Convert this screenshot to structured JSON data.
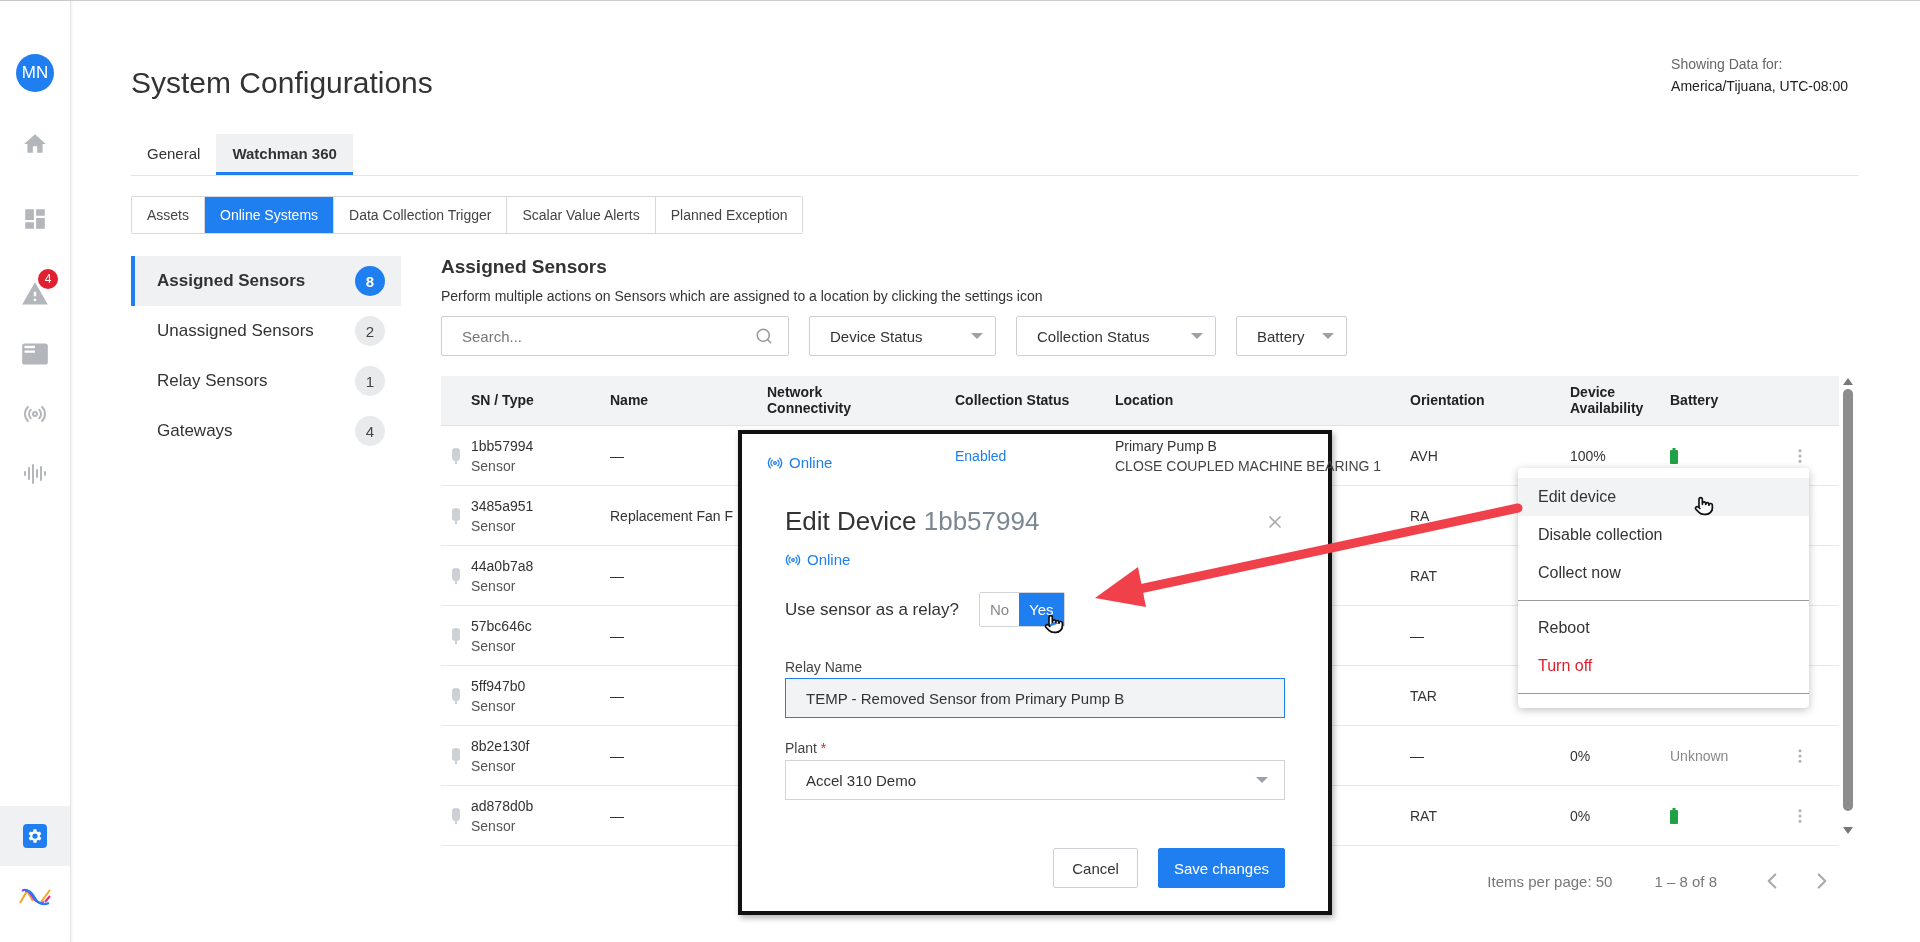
{
  "user": {
    "initials": "MN"
  },
  "nav_rail": [
    {
      "kind": "home",
      "selected": false
    },
    {
      "kind": "dashboard",
      "selected": false
    },
    {
      "kind": "alert",
      "selected": false,
      "badge": "4"
    },
    {
      "kind": "monitor",
      "selected": false
    },
    {
      "kind": "wireless",
      "selected": false
    },
    {
      "kind": "waveform",
      "selected": false
    }
  ],
  "nav_rail_bottom": [
    {
      "kind": "settings",
      "selected": true
    },
    {
      "kind": "logo",
      "selected": false
    }
  ],
  "page_title": "System Configurations",
  "timezone": {
    "label": "Showing Data for:",
    "value": "America/Tijuana, UTC-08:00"
  },
  "tabs": [
    {
      "label": "General",
      "selected": false
    },
    {
      "label": "Watchman 360",
      "selected": true
    }
  ],
  "subtabs": [
    {
      "label": "Assets",
      "selected": false
    },
    {
      "label": "Online Systems",
      "selected": true
    },
    {
      "label": "Data Collection Trigger",
      "selected": false
    },
    {
      "label": "Scalar Value Alerts",
      "selected": false
    },
    {
      "label": "Planned Exception",
      "selected": false
    }
  ],
  "side_nav": [
    {
      "label": "Assigned Sensors",
      "count": "8",
      "selected": true
    },
    {
      "label": "Unassigned Sensors",
      "count": "2",
      "selected": false
    },
    {
      "label": "Relay Sensors",
      "count": "1",
      "selected": false
    },
    {
      "label": "Gateways",
      "count": "4",
      "selected": false
    }
  ],
  "section": {
    "title": "Assigned Sensors",
    "description": "Perform multiple actions on Sensors which are assigned to a location by clicking the settings icon"
  },
  "search": {
    "placeholder": "Search..."
  },
  "filters": [
    "Device Status",
    "Collection Status",
    "Battery"
  ],
  "table": {
    "columns": [
      "SN / Type",
      "Name",
      "Network Connectivity",
      "Collection Status",
      "Location",
      "Orientation",
      "Device Availability",
      "Battery"
    ],
    "rows": [
      {
        "sn": "1bb57994",
        "type": "Sensor",
        "name": "—",
        "network": "Online",
        "collection": "Enabled",
        "location": "Primary Pump B",
        "location_detail": "CLOSE COUPLED MACHINE BEARING 1",
        "orientation": "AVH",
        "availability": "100%",
        "battery": {
          "kind": "full"
        },
        "menu": true
      },
      {
        "sn": "3485a951",
        "type": "Sensor",
        "name": "Replacement Fan F",
        "orientation": "RA"
      },
      {
        "sn": "44a0b7a8",
        "type": "Sensor",
        "name": "—",
        "orientation": "RAT"
      },
      {
        "sn": "57bc646c",
        "type": "Sensor",
        "name": "—",
        "orientation": "—"
      },
      {
        "sn": "5ff947b0",
        "type": "Sensor",
        "name": "—",
        "orientation": "TAR"
      },
      {
        "sn": "8b2e130f",
        "type": "Sensor",
        "name": "—",
        "orientation": "—",
        "availability": "0%",
        "battery": {
          "kind": "unknown",
          "label": "Unknown"
        },
        "menu": true
      },
      {
        "sn": "ad878d0b",
        "type": "Sensor",
        "name": "—",
        "orientation": "RAT",
        "availability": "0%",
        "battery": {
          "kind": "full"
        },
        "menu": true
      }
    ]
  },
  "pagination": {
    "items_per_page": "Items per page: 50",
    "range": "1 – 8 of 8"
  },
  "dialog": {
    "title": "Edit Device",
    "device_id": "1bb57994",
    "status": "Online",
    "relay_question": "Use sensor as a relay?",
    "relay_options": [
      {
        "label": "No",
        "selected": false
      },
      {
        "label": "Yes",
        "selected": true
      }
    ],
    "relay_name": {
      "label": "Relay Name",
      "value": "TEMP - Removed Sensor from Primary Pump B"
    },
    "plant": {
      "label": "Plant",
      "required_mark": "*",
      "value": "Accel 310 Demo"
    },
    "buttons": [
      {
        "label": "Cancel",
        "kind": "secondary"
      },
      {
        "label": "Save changes",
        "kind": "primary"
      }
    ]
  },
  "context_menu": [
    [
      {
        "label": "Edit device",
        "selected": true,
        "kind": "normal"
      },
      {
        "label": "Disable collection",
        "selected": false,
        "kind": "normal"
      },
      {
        "label": "Collect now",
        "selected": false,
        "kind": "normal"
      }
    ],
    [
      {
        "label": "Reboot",
        "selected": false,
        "kind": "normal"
      },
      {
        "label": "Turn off",
        "selected": false,
        "kind": "danger"
      }
    ]
  ]
}
